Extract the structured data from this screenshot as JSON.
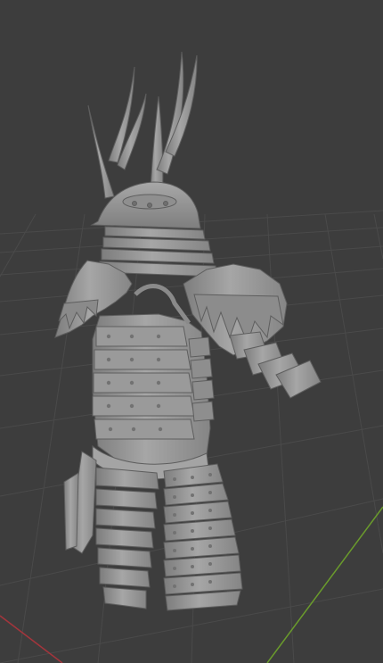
{
  "app": {
    "title": ""
  },
  "viewport": {
    "mode_label": "",
    "background_color": "#3d3d3d",
    "grid_color": "#4a4a4a",
    "x_axis_color": "#a3353c",
    "y_axis_color": "#6a9b2c",
    "object": {
      "icon": "samurai-armor-model",
      "shade_color": "#9c9c9c"
    }
  }
}
